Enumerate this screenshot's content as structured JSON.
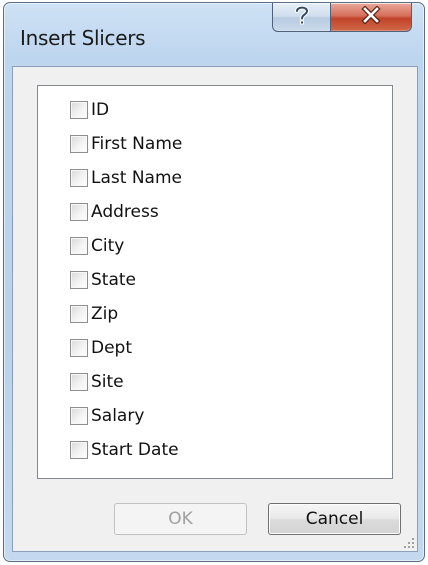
{
  "window": {
    "title": "Insert Slicers"
  },
  "titlebar": {
    "help_icon": "help-question-icon",
    "close_icon": "close-x-icon",
    "close_color": "#c8452d"
  },
  "fields": [
    {
      "label": "ID",
      "checked": false
    },
    {
      "label": "First Name",
      "checked": false
    },
    {
      "label": "Last Name",
      "checked": false
    },
    {
      "label": "Address",
      "checked": false
    },
    {
      "label": "City",
      "checked": false
    },
    {
      "label": "State",
      "checked": false
    },
    {
      "label": "Zip",
      "checked": false
    },
    {
      "label": "Dept",
      "checked": false
    },
    {
      "label": "Site",
      "checked": false
    },
    {
      "label": "Salary",
      "checked": false
    },
    {
      "label": "Start Date",
      "checked": false
    }
  ],
  "buttons": {
    "ok_label": "OK",
    "ok_enabled": false,
    "cancel_label": "Cancel"
  }
}
